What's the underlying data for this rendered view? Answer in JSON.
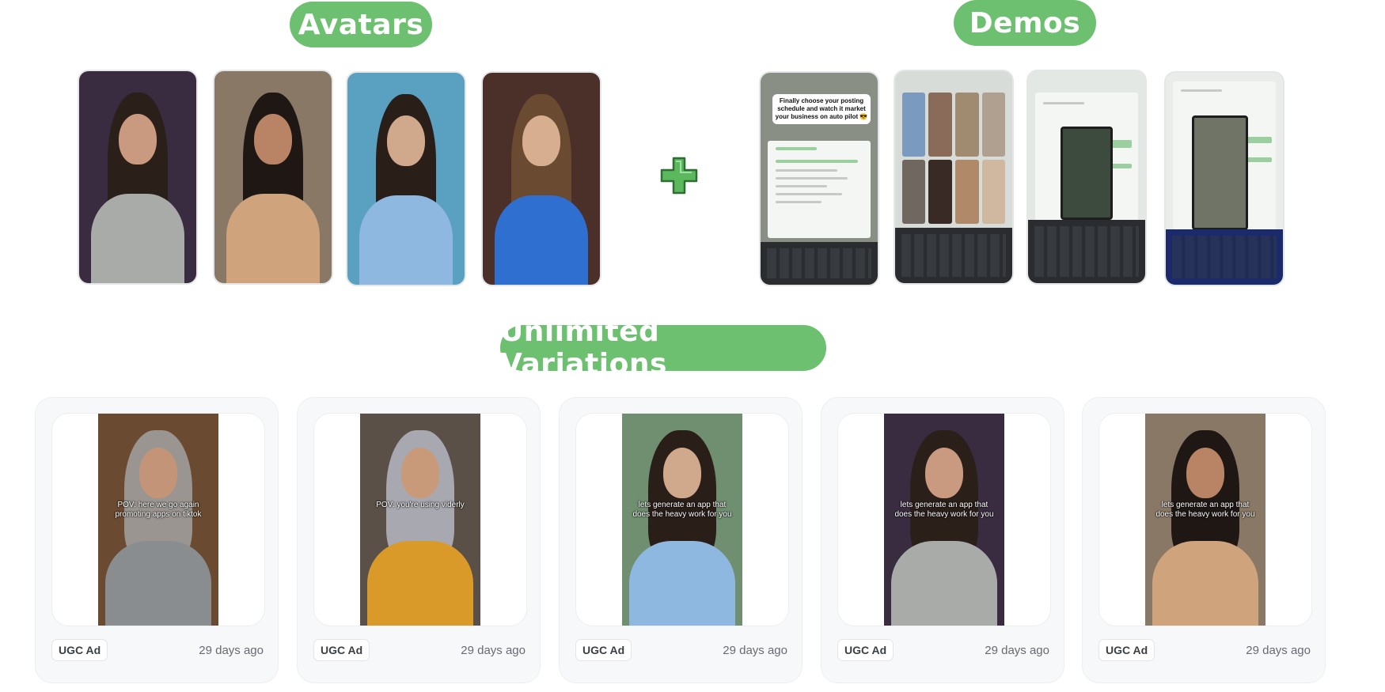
{
  "headings": {
    "avatars": "Avatars",
    "demos": "Demos",
    "variations": "Unlimited Variations"
  },
  "colors": {
    "accent_green": "#6cc070",
    "card_bg": "#f7f8f9"
  },
  "avatars": [
    {
      "name": "avatar-1",
      "hair": "#2b1f1a",
      "skin": "#c99a80",
      "top": "#a9aba9",
      "bg": "#3a2c40"
    },
    {
      "name": "avatar-2",
      "hair": "#1e1714",
      "skin": "#b98466",
      "top": "#cfa47c",
      "bg": "#8a7866"
    },
    {
      "name": "avatar-3",
      "hair": "#2a1e18",
      "skin": "#d0a88c",
      "top": "#8fb8e0",
      "bg": "#5aa0c0"
    },
    {
      "name": "avatar-4",
      "hair": "#6a4a30",
      "skin": "#d8ae90",
      "top": "#2f6fd0",
      "bg": "#4a3028"
    }
  ],
  "demos": {
    "first_caption": "Finally choose your posting schedule and watch it market your business on auto pilot 😎"
  },
  "plus_icon": "plus-icon",
  "cards": [
    {
      "badge": "UGC Ad",
      "time": "29 days ago",
      "caption": "POV: here we go again promoting apps on tiktok",
      "hair": "#9a9590",
      "skin": "#c49478",
      "top": "#8a8d90",
      "bg": "#6a4a30"
    },
    {
      "badge": "UGC Ad",
      "time": "29 days ago",
      "caption": "POV: you're using viderly",
      "hair": "#a8a8b0",
      "skin": "#c89a7a",
      "top": "#d99a2a",
      "bg": "#5a5048"
    },
    {
      "badge": "UGC Ad",
      "time": "29 days ago",
      "caption": "lets generate an app that does the heavy work for you",
      "hair": "#2a1e18",
      "skin": "#d0a88c",
      "top": "#8fb8e0",
      "bg": "#6f8f70"
    },
    {
      "badge": "UGC Ad",
      "time": "29 days ago",
      "caption": "lets generate an app that does the heavy work for you",
      "hair": "#2b1f1a",
      "skin": "#c99a80",
      "top": "#a9aba9",
      "bg": "#3a2c40"
    },
    {
      "badge": "UGC Ad",
      "time": "29 days ago",
      "caption": "lets generate an app that does the heavy work for you",
      "hair": "#1e1714",
      "skin": "#b98466",
      "top": "#cfa47c",
      "bg": "#8a7866"
    }
  ]
}
